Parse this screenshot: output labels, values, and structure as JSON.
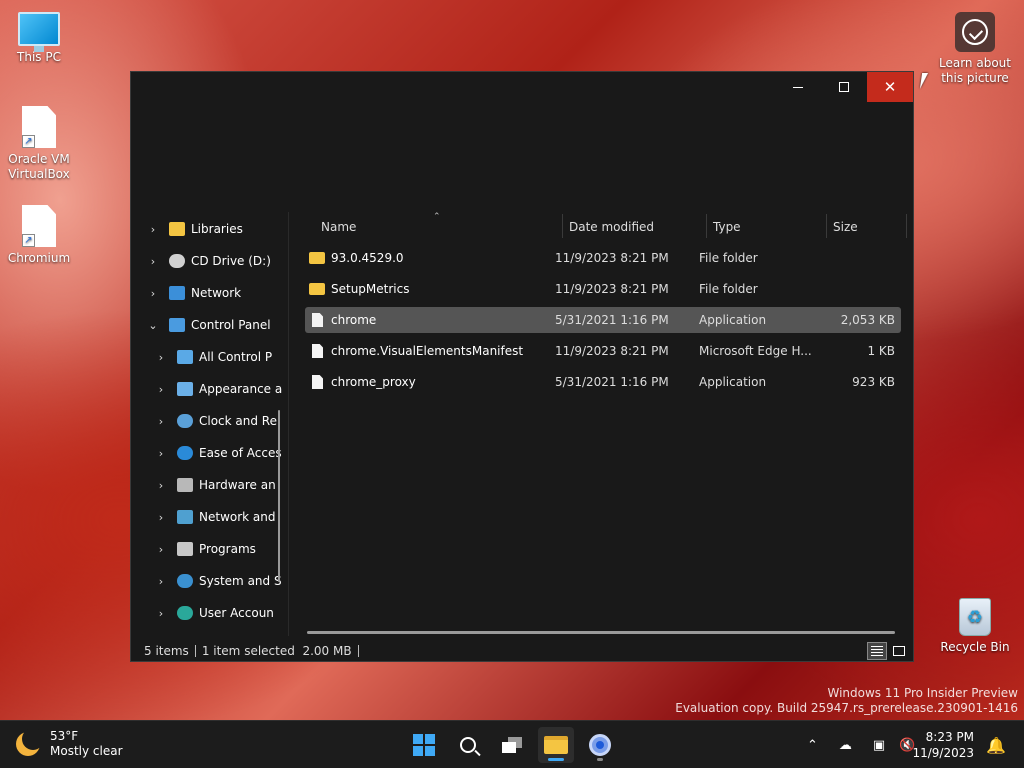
{
  "desktop": {
    "icons": [
      {
        "label": "This PC"
      },
      {
        "label": "Oracle VM VirtualBox"
      },
      {
        "label": "Chromium"
      },
      {
        "label": "Learn about this picture"
      },
      {
        "label": "Recycle Bin"
      }
    ],
    "watermark": {
      "line1": "Windows 11 Pro Insider Preview",
      "line2": "Evaluation copy. Build 25947.rs_prerelease.230901-1416"
    }
  },
  "window": {
    "controls": {
      "minimize": "—",
      "maximize": "☐",
      "close": "✕"
    },
    "nav_pane": {
      "items": [
        {
          "label": "Libraries",
          "expanded": false,
          "icon": "library-icon"
        },
        {
          "label": "CD Drive (D:)",
          "expanded": false,
          "icon": "cd-drive-icon"
        },
        {
          "label": "Network",
          "expanded": false,
          "icon": "network-icon"
        },
        {
          "label": "Control Panel",
          "expanded": true,
          "icon": "control-panel-icon"
        },
        {
          "label": "All Control P",
          "expanded": false,
          "icon": "all-control-panel-icon"
        },
        {
          "label": "Appearance a",
          "expanded": false,
          "icon": "appearance-icon"
        },
        {
          "label": "Clock and Re",
          "expanded": false,
          "icon": "clock-icon"
        },
        {
          "label": "Ease of Acces",
          "expanded": false,
          "icon": "ease-of-access-icon"
        },
        {
          "label": "Hardware an",
          "expanded": false,
          "icon": "hardware-icon"
        },
        {
          "label": "Network and",
          "expanded": false,
          "icon": "network-and-internet-icon"
        },
        {
          "label": "Programs",
          "expanded": false,
          "icon": "programs-icon"
        },
        {
          "label": "System and S",
          "expanded": false,
          "icon": "system-security-icon"
        },
        {
          "label": "User Accoun",
          "expanded": false,
          "icon": "user-accounts-icon"
        }
      ]
    },
    "columns": {
      "name": "Name",
      "date": "Date modified",
      "type": "Type",
      "size": "Size"
    },
    "files": [
      {
        "name": "93.0.4529.0",
        "date": "11/9/2023 8:21 PM",
        "type": "File folder",
        "size": "",
        "kind": "folder",
        "selected": false
      },
      {
        "name": "SetupMetrics",
        "date": "11/9/2023 8:21 PM",
        "type": "File folder",
        "size": "",
        "kind": "folder",
        "selected": false
      },
      {
        "name": "chrome",
        "date": "5/31/2021 1:16 PM",
        "type": "Application",
        "size": "2,053 KB",
        "kind": "file",
        "selected": true
      },
      {
        "name": "chrome.VisualElementsManifest",
        "date": "11/9/2023 8:21 PM",
        "type": "Microsoft Edge H...",
        "size": "1 KB",
        "kind": "file",
        "selected": false
      },
      {
        "name": "chrome_proxy",
        "date": "5/31/2021 1:16 PM",
        "type": "Application",
        "size": "923 KB",
        "kind": "file",
        "selected": false
      }
    ],
    "status": {
      "count": "5 items",
      "selection": "1 item selected  2.00 MB"
    }
  },
  "taskbar": {
    "weather": {
      "temp": "53°F",
      "condition": "Mostly clear"
    },
    "clock": {
      "time": "8:23 PM",
      "date": "11/9/2023"
    },
    "colors": {
      "accent": "#3fa9f5",
      "close_red": "#c42b1c",
      "folder": "#f4c542"
    }
  }
}
